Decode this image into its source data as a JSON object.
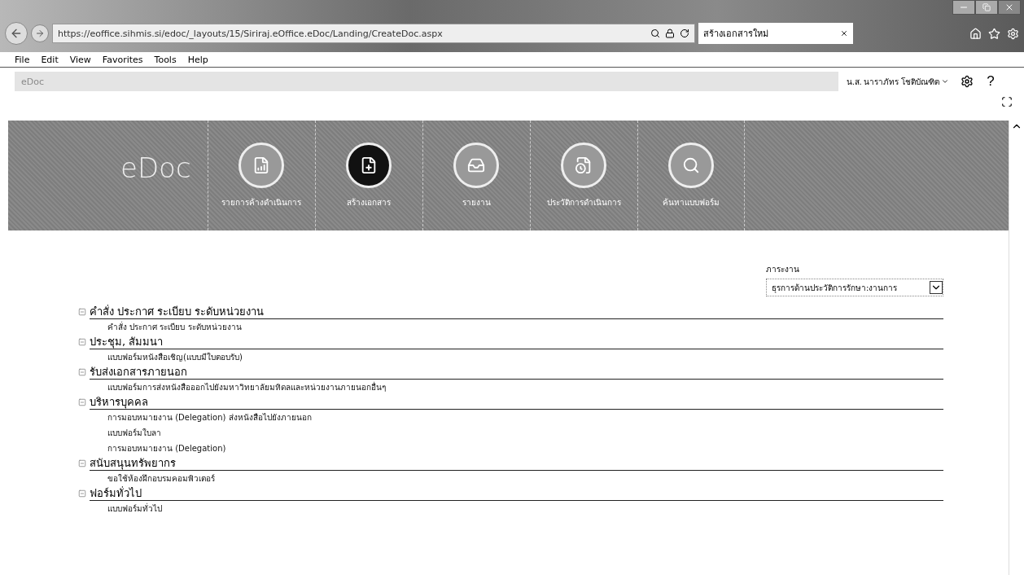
{
  "browser": {
    "url": "https://eoffice.sihmis.si/edoc/_layouts/15/Siriraj.eOffice.eDoc/Landing/CreateDoc.aspx",
    "tab": {
      "title": "สร้างเอกสารใหม่",
      "selected": true
    },
    "menu": [
      "File",
      "Edit",
      "View",
      "Favorites",
      "Tools",
      "Help"
    ]
  },
  "suite_bar": {
    "brand": "eDoc",
    "user": "น.ส. นาราภัทร โชติบัณฑิต",
    "help": "?"
  },
  "banner": {
    "logo": "eDoc",
    "nav": [
      {
        "label": "รายการค้างดำเนินการ",
        "kind": "chart",
        "selected": false
      },
      {
        "label": "สร้างเอกสาร",
        "kind": "create",
        "selected": true
      },
      {
        "label": "รายงาน",
        "kind": "inbox",
        "selected": false
      },
      {
        "label": "ประวัติการดำเนินการ",
        "kind": "history",
        "selected": false
      },
      {
        "label": "ค้นหาแบบฟอร์ม",
        "kind": "search",
        "selected": false
      }
    ]
  },
  "workload": {
    "label": "ภาระงาน",
    "value": "ธุรการด้านประวัติการรักษา:งานการ"
  },
  "categories": [
    {
      "title": "คำสั่ง ประกาศ ระเบียบ ระดับหน่วยงาน",
      "expanded": true,
      "children": [
        {
          "title": "คำสั่ง ประกาศ ระเบียบ ระดับหน่วยงาน"
        }
      ]
    },
    {
      "title": "ประชุม, สัมมนา",
      "expanded": true,
      "children": [
        {
          "title": "แบบฟอร์มหนังสือเชิญ(แบบมีใบตอบรับ)"
        }
      ]
    },
    {
      "title": "รับส่งเอกสารภายนอก",
      "expanded": true,
      "children": [
        {
          "title": "แบบฟอร์มการส่งหนังสือออกไปยังมหาวิทยาลัยมหิดลและหน่วยงานภายนอกอื่นๆ"
        }
      ]
    },
    {
      "title": "บริหารบุคคล",
      "expanded": true,
      "children": [
        {
          "title": "การมอบหมายงาน (Delegation) ส่งหนังสือไปยังภายนอก"
        },
        {
          "title": "แบบฟอร์มใบลา"
        },
        {
          "title": "การมอบหมายงาน (Delegation)"
        }
      ]
    },
    {
      "title": "สนับสนุนทรัพยากร",
      "expanded": true,
      "children": [
        {
          "title": "ขอใช้ห้องฝึกอบรมคอมพิวเตอร์"
        }
      ]
    },
    {
      "title": "ฟอร์มทั่วไป",
      "expanded": true,
      "children": [
        {
          "title": "แบบฟอร์มทั่วไป"
        }
      ]
    }
  ]
}
